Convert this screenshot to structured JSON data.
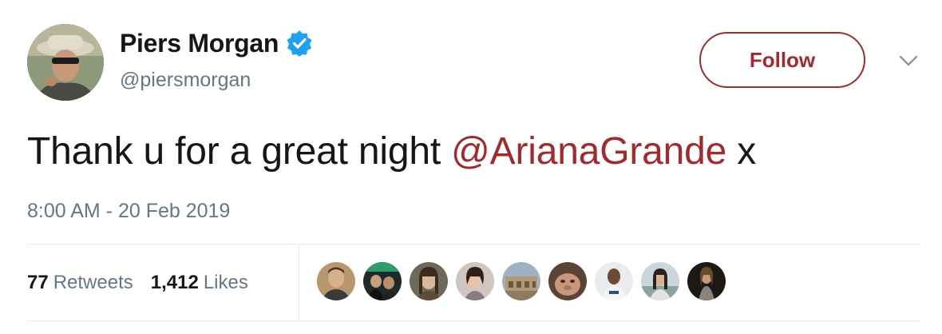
{
  "author": {
    "display_name": "Piers Morgan",
    "handle": "@piersmorgan",
    "verified": true,
    "verified_icon": "verified-badge-icon",
    "verified_color": "#1da1f2"
  },
  "actions": {
    "follow_label": "Follow",
    "menu_icon": "chevron-down-icon"
  },
  "tweet": {
    "text_prefix": "Thank u for a great night ",
    "mention": "@ArianaGrande",
    "text_suffix": " x",
    "timestamp": "8:00 AM - 20 Feb 2019"
  },
  "stats": {
    "retweets_count": "77",
    "retweets_label": "Retweets",
    "likes_count": "1,412",
    "likes_label": "Likes"
  },
  "liked_by_avatar_count": 9,
  "colors": {
    "accent": "#a32a2c",
    "secondary_text": "#657786",
    "primary_text": "#14171a",
    "divider": "#e6ecf0"
  }
}
